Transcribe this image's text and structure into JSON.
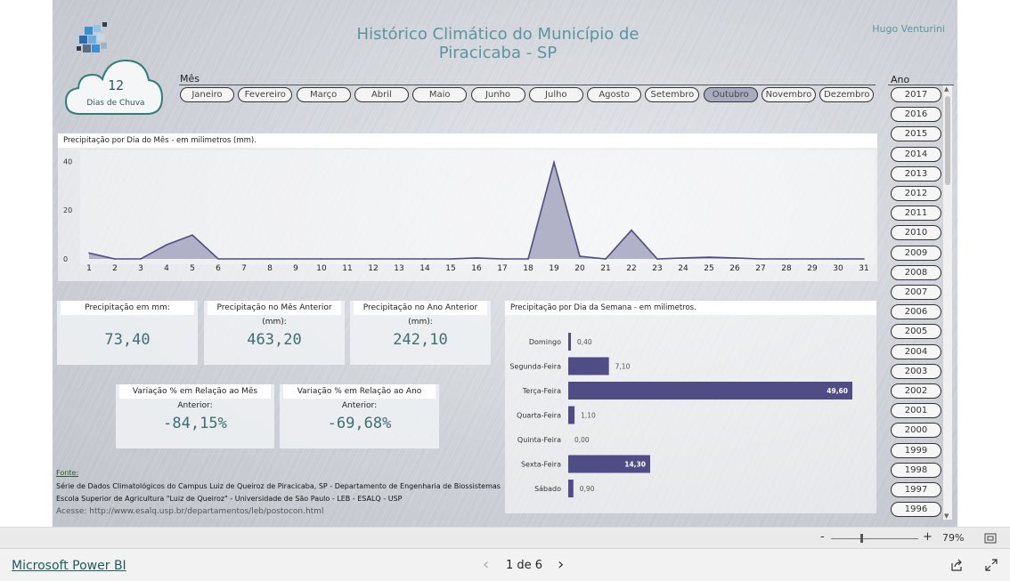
{
  "report": {
    "title": "Histórico Climático do Município de Piracicaba - SP",
    "author": "Hugo Venturini",
    "rain_days_count": "12",
    "rain_days_label": "Dias de Chuva",
    "month_label": "Mês",
    "year_label": "Ano",
    "months": [
      "Janeiro",
      "Fevereiro",
      "Março",
      "Abril",
      "Maio",
      "Junho",
      "Julho",
      "Agosto",
      "Setembro",
      "Outubro",
      "Novembro",
      "Dezembro"
    ],
    "selected_month": "Outubro",
    "years": [
      "2017",
      "2016",
      "2015",
      "2014",
      "2013",
      "2012",
      "2011",
      "2010",
      "2009",
      "2008",
      "2007",
      "2006",
      "2005",
      "2004",
      "2003",
      "2002",
      "2001",
      "2000",
      "1999",
      "1998",
      "1997",
      "1996"
    ],
    "cards": {
      "precip": {
        "label": "Precipitação em mm:",
        "value": "73,40"
      },
      "prev_month": {
        "label": "Precipitação no Mês Anterior (mm):",
        "value": "463,20"
      },
      "prev_year": {
        "label": "Precipitação no Ano Anterior (mm):",
        "value": "242,10"
      },
      "var_month": {
        "label": "Variação % em Relação ao Mês Anterior:",
        "value": "-84,15%"
      },
      "var_year": {
        "label": "Variação % em Relação ao Ano Anterior:",
        "value": "-69,68%"
      }
    },
    "source": {
      "heading": "Fonte:",
      "line1": "Série de Dados Climatológicos do Campus Luiz de Queiroz de Piracicaba, SP - Departamento de Engenharia de Biossistemas",
      "line2": "Escola Superior de Agricultura \"Luiz de Queiroz\" - Universidade de São Paulo - LEB - ESALQ - USP",
      "line3": "Acesse: http://www.esalq.usp.br/departamentos/leb/postocon.html"
    }
  },
  "viewer": {
    "zoom": "79%",
    "zoom_minus": "-",
    "zoom_plus": "+",
    "brand": "Microsoft Power BI",
    "page_indicator": "1 de 6",
    "prev": "‹",
    "next": "›"
  },
  "colors": {
    "accent": "#4f4c86",
    "area_fill": "#a5a6c0",
    "title_teal": "#5a95a4",
    "value_teal": "#3e6e75"
  },
  "chart_data": [
    {
      "type": "area",
      "title": "Precipitação por Dia do Mês - em milimetros (mm).",
      "x": [
        1,
        2,
        3,
        4,
        5,
        6,
        7,
        8,
        9,
        10,
        11,
        12,
        13,
        14,
        15,
        16,
        17,
        18,
        19,
        20,
        21,
        22,
        23,
        24,
        25,
        26,
        27,
        28,
        29,
        30,
        31
      ],
      "values": [
        2.4,
        0,
        0,
        5.8,
        9.8,
        0,
        0,
        0,
        0,
        0,
        0,
        0,
        0,
        0,
        0,
        0.4,
        0,
        0,
        39.6,
        1.1,
        0,
        11.8,
        0,
        0.4,
        0.7,
        0.4,
        0,
        0,
        0,
        0,
        0
      ],
      "yticks": [
        0,
        20,
        40
      ],
      "ylim": [
        0,
        42
      ],
      "grid": false
    },
    {
      "type": "bar",
      "orientation": "horizontal",
      "title": "Precipitação por Dia da Semana - em milimetros.",
      "categories": [
        "Domingo",
        "Segunda-Feira",
        "Terça-Feira",
        "Quarta-Feira",
        "Quinta-Feira",
        "Sexta-Feira",
        "Sábado"
      ],
      "values": [
        0.4,
        7.1,
        49.6,
        1.1,
        0,
        14.3,
        0.9
      ],
      "labels": [
        "0,40",
        "7,10",
        "49,60",
        "1,10",
        "0,00",
        "14,30",
        "0,90"
      ],
      "xlim": [
        0,
        49.6
      ]
    }
  ]
}
